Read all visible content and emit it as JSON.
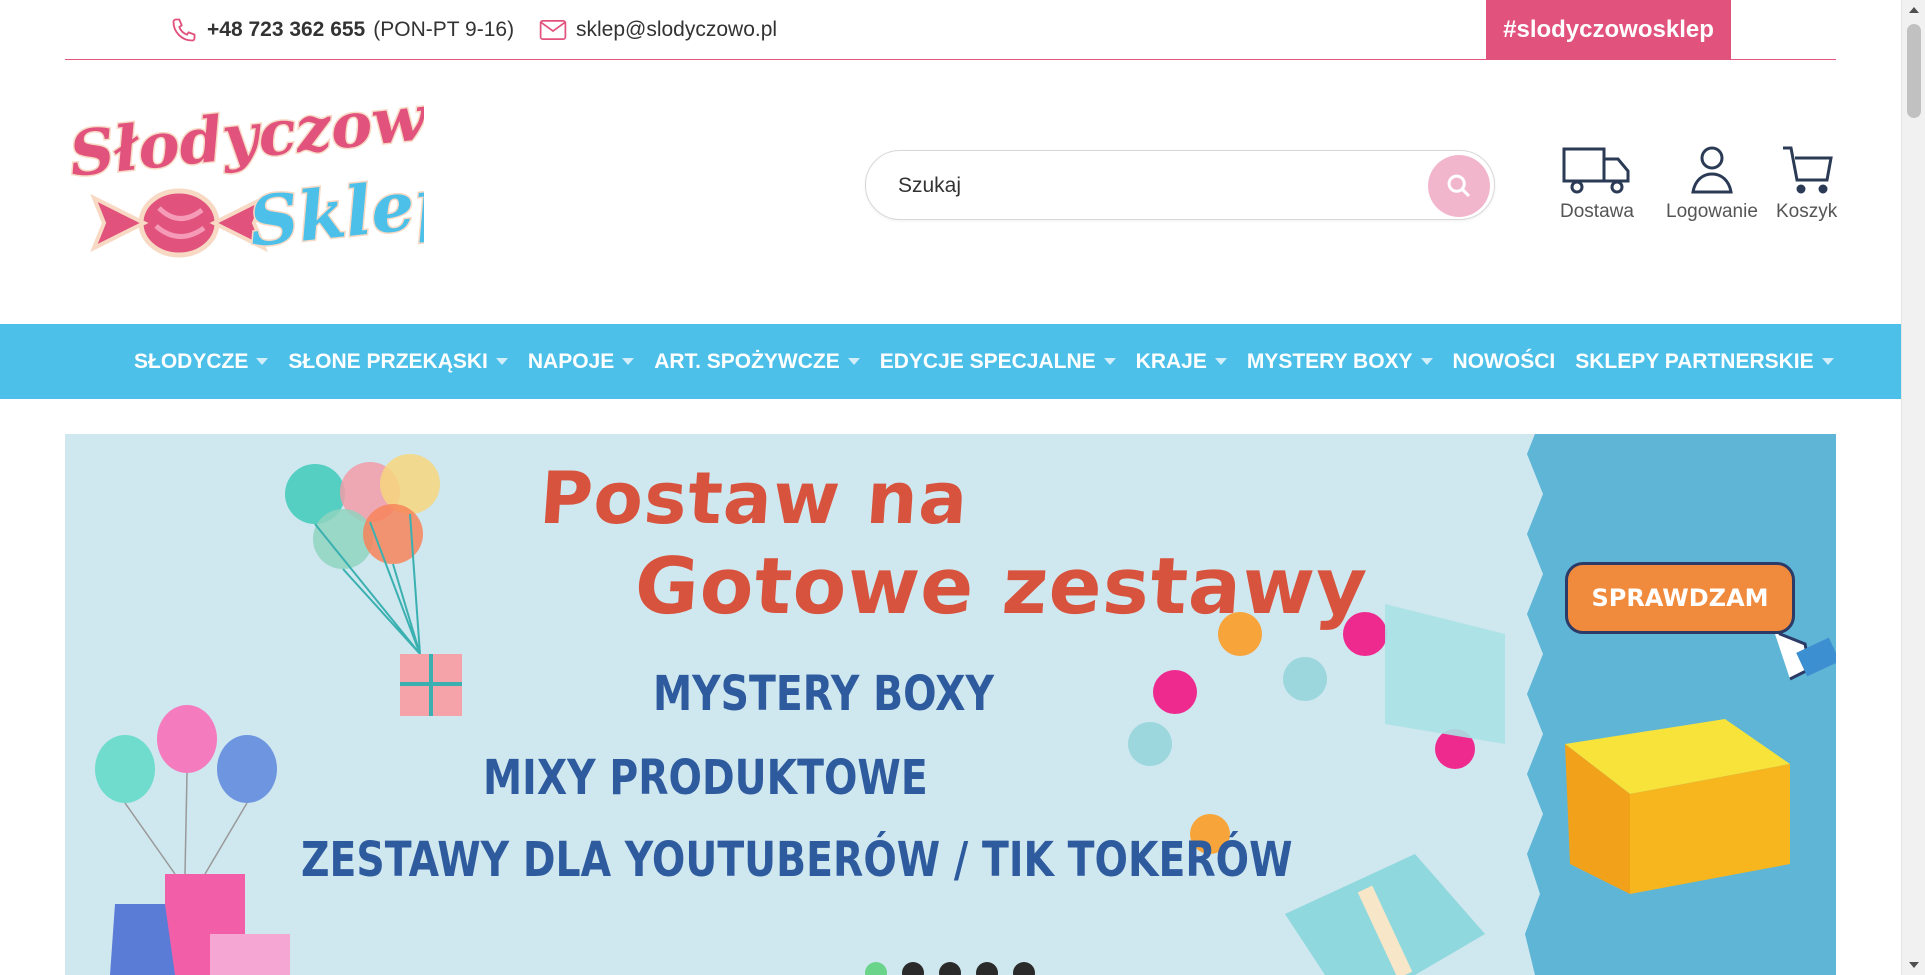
{
  "topbar": {
    "phone": "+48 723 362 655",
    "hours": "(PON-PT 9-16)",
    "email": "sklep@slodyczowo.pl",
    "hashtag": "#slodyczowosklep"
  },
  "logo": {
    "line1": "Słodyczowo",
    "line2": "Sklep"
  },
  "search": {
    "placeholder": "Szukaj"
  },
  "header_icons": {
    "delivery": "Dostawa",
    "login": "Logowanie",
    "cart": "Koszyk"
  },
  "nav": {
    "items": [
      {
        "label": "SŁODYCZE",
        "dropdown": true
      },
      {
        "label": "SŁONE PRZEKĄSKI",
        "dropdown": true
      },
      {
        "label": "NAPOJE",
        "dropdown": true
      },
      {
        "label": "ART. SPOŻYWCZE",
        "dropdown": true
      },
      {
        "label": "EDYCJE SPECJALNE",
        "dropdown": true
      },
      {
        "label": "KRAJE",
        "dropdown": true
      },
      {
        "label": "MYSTERY BOXY",
        "dropdown": true
      },
      {
        "label": "NOWOŚCI",
        "dropdown": false
      },
      {
        "label": "SKLEPY PARTNERSKIE",
        "dropdown": true
      }
    ]
  },
  "hero": {
    "headline1": "Postaw na",
    "headline2": "Gotowe zestawy",
    "line1": "MYSTERY BOXY",
    "line2": "MIXY PRODUKTOWE",
    "line3": "ZESTAWY DLA YOUTUBERÓW / TIK TOKERÓW",
    "cta": "SPRAWDZAM",
    "slides_count": 5,
    "active_slide": 1
  },
  "colors": {
    "brand_pink": "#e1527d",
    "nav_blue": "#4dc0ea",
    "hero_bg": "#cfe7ef",
    "headline_red": "#d8533d",
    "text_blue": "#2e5a9e"
  }
}
